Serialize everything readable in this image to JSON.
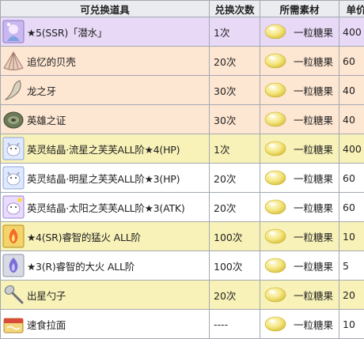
{
  "headers": {
    "item": "可兑换道具",
    "times": "兑换次数",
    "material": "所需素材",
    "price": "单价"
  },
  "rows": [
    {
      "name": "★5(SSR)「潜水」",
      "times": "1次",
      "material": "一粒糖果",
      "price": "400",
      "color": "purple",
      "icon": "servant-card-icon"
    },
    {
      "name": "追忆的贝壳",
      "times": "20次",
      "material": "一粒糖果",
      "price": "60",
      "color": "orange",
      "icon": "shell-icon"
    },
    {
      "name": "龙之牙",
      "times": "30次",
      "material": "一粒糖果",
      "price": "40",
      "color": "orange",
      "icon": "dragon-fang-icon"
    },
    {
      "name": "英雄之证",
      "times": "30次",
      "material": "一粒糖果",
      "price": "40",
      "color": "orange",
      "icon": "hero-proof-icon"
    },
    {
      "name": "英灵结晶·流星之芙芙ALL阶★4(HP)",
      "times": "1次",
      "material": "一粒糖果",
      "price": "400",
      "color": "yellow",
      "icon": "fou-icon"
    },
    {
      "name": "英灵结晶·明星之芙芙ALL阶★3(HP)",
      "times": "20次",
      "material": "一粒糖果",
      "price": "60",
      "color": "white",
      "icon": "fou-icon"
    },
    {
      "name": "英灵结晶·太阳之芙芙ALL阶★3(ATK)",
      "times": "20次",
      "material": "一粒糖果",
      "price": "60",
      "color": "white",
      "icon": "fou-atk-icon"
    },
    {
      "name": "★4(SR)睿智的猛火 ALL阶",
      "times": "100次",
      "material": "一粒糖果",
      "price": "10",
      "color": "yellow",
      "icon": "ember-gold-icon"
    },
    {
      "name": "★3(R)睿智的大火 ALL阶",
      "times": "100次",
      "material": "一粒糖果",
      "price": "5",
      "color": "white",
      "icon": "ember-silver-icon"
    },
    {
      "name": "出星勺子",
      "times": "20次",
      "material": "一粒糖果",
      "price": "20",
      "color": "yellow",
      "icon": "spoon-icon"
    },
    {
      "name": "速食拉面",
      "times": "----",
      "material": "一粒糖果",
      "price": "10",
      "color": "white",
      "icon": "ramen-icon"
    }
  ],
  "colors": {
    "purple": "#e8daf7",
    "orange": "#fde6d2",
    "yellow": "#f8f2b8",
    "white": "#ffffff",
    "header": "#eaecf0",
    "border": "#a2a9b1"
  }
}
